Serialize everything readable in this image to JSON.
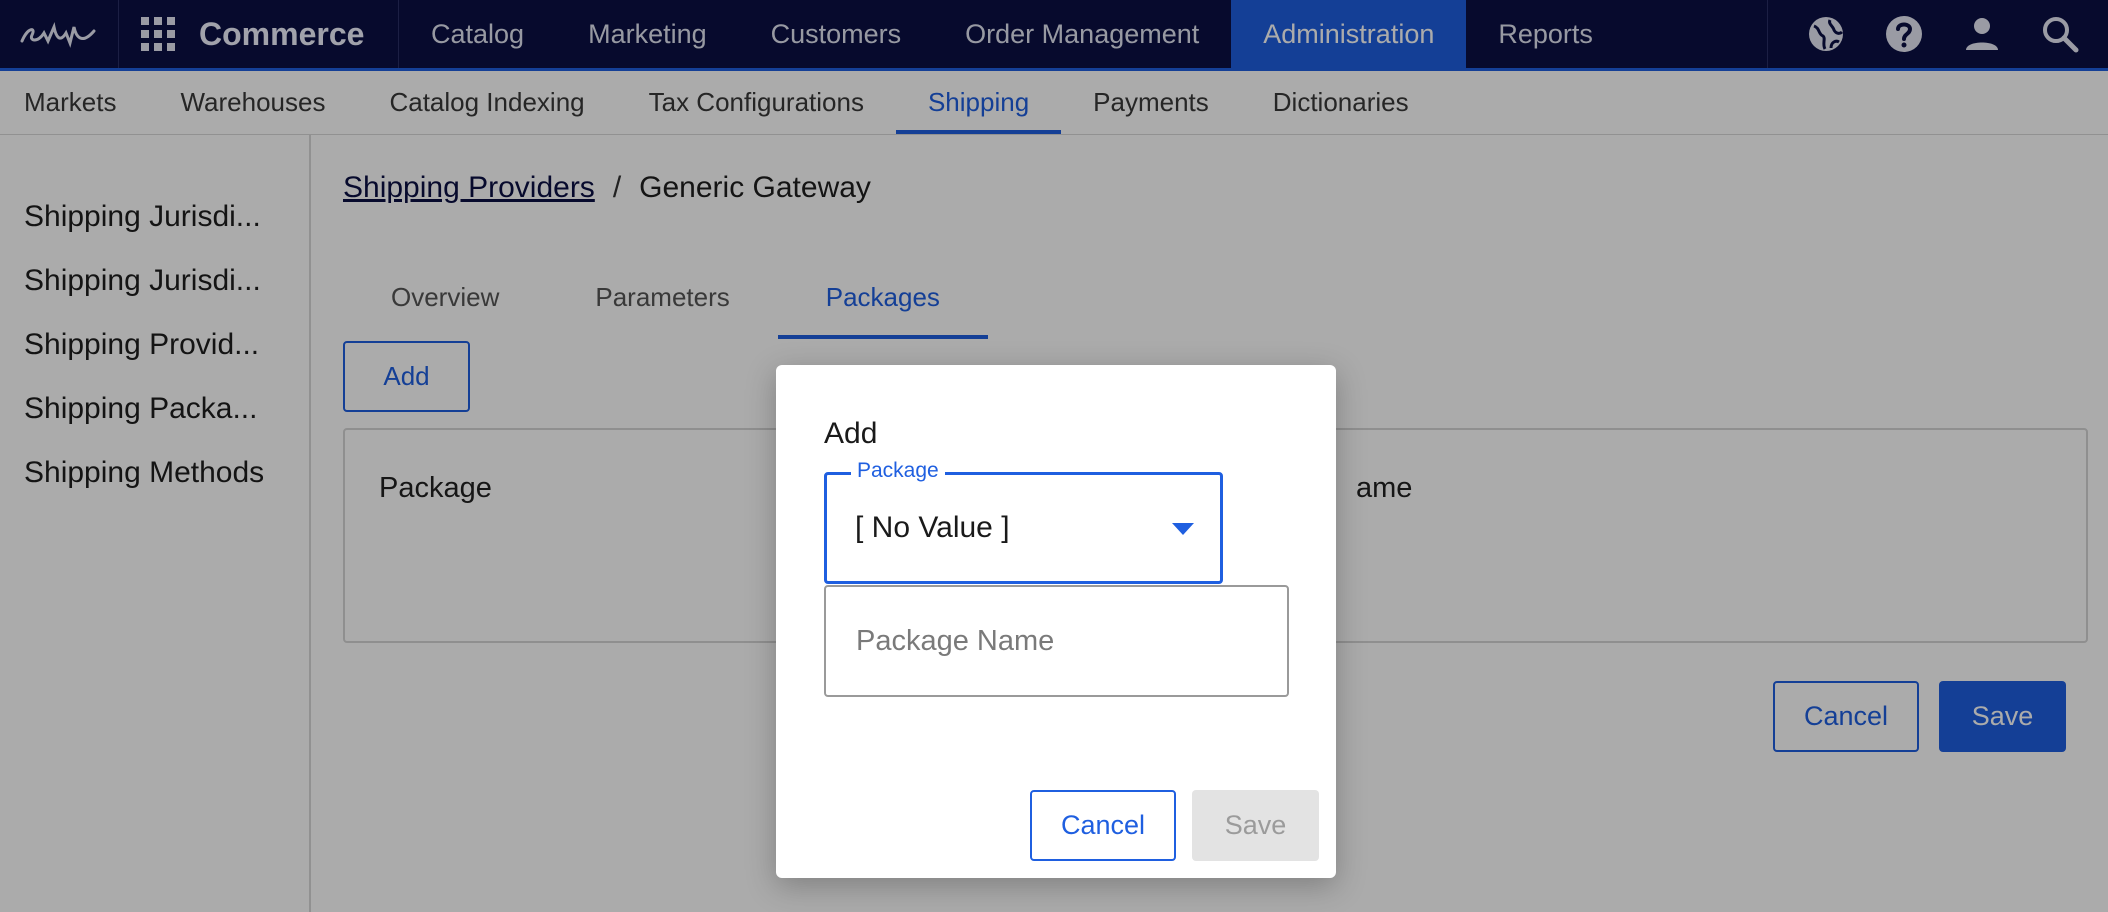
{
  "topnav": {
    "app_name": "Commerce",
    "items": [
      "Catalog",
      "Marketing",
      "Customers",
      "Order Management",
      "Administration",
      "Reports"
    ],
    "active_index": 4,
    "icons": [
      "globe-icon",
      "help-icon",
      "user-icon",
      "search-icon"
    ]
  },
  "subnav": {
    "items": [
      "Markets",
      "Warehouses",
      "Catalog Indexing",
      "Tax Configurations",
      "Shipping",
      "Payments",
      "Dictionaries"
    ],
    "active_index": 4
  },
  "sidebar": {
    "items": [
      "Shipping Jurisdi...",
      "Shipping Jurisdi...",
      "Shipping Provid...",
      "Shipping Packa...",
      "Shipping Methods"
    ]
  },
  "breadcrumb": {
    "link": "Shipping Providers",
    "separator": "/",
    "current": "Generic Gateway"
  },
  "tabs": {
    "items": [
      "Overview",
      "Parameters",
      "Packages"
    ],
    "active_index": 2
  },
  "main": {
    "add_label": "Add",
    "columns": [
      "Package",
      "ame"
    ],
    "cancel_label": "Cancel",
    "save_label": "Save"
  },
  "modal": {
    "title": "Add",
    "package_label": "Package",
    "package_value": "[ No Value ]",
    "package_name_placeholder": "Package Name",
    "cancel_label": "Cancel",
    "save_label": "Save"
  },
  "colors": {
    "nav_bg": "#0b1044",
    "accent": "#1f5fe0",
    "disabled_bg": "#e3e3e3"
  }
}
